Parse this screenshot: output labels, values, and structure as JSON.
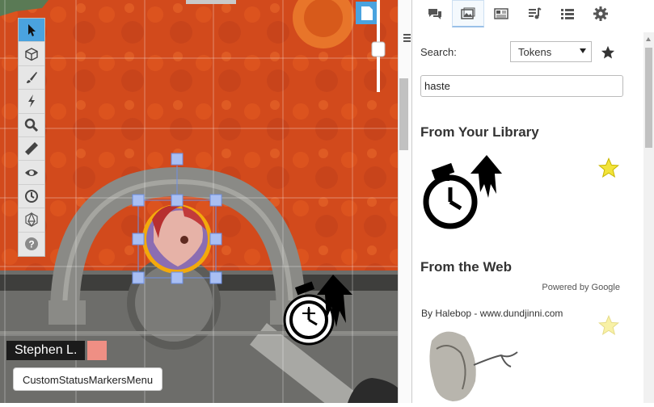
{
  "left_panel": {
    "player_name": "Stephen L.",
    "player_color": "#ef8f84",
    "status_markers_button": "CustomStatusMarkersMenu",
    "toolbar": [
      {
        "name": "select",
        "icon": "pointer-icon",
        "active": true
      },
      {
        "name": "token-layer",
        "icon": "cube-icon"
      },
      {
        "name": "draw",
        "icon": "brush-icon"
      },
      {
        "name": "fx",
        "icon": "lightning-icon"
      },
      {
        "name": "zoom",
        "icon": "magnifier-icon"
      },
      {
        "name": "measure",
        "icon": "ruler-icon"
      },
      {
        "name": "fog",
        "icon": "eye-icon"
      },
      {
        "name": "turn-tracker",
        "icon": "clock-icon"
      },
      {
        "name": "dice",
        "icon": "d20-icon"
      },
      {
        "name": "help",
        "icon": "help-icon"
      }
    ]
  },
  "sidebar": {
    "tabs": [
      {
        "name": "chat",
        "icon": "chat-bubbles-icon"
      },
      {
        "name": "art-library",
        "icon": "image-icon",
        "active": true
      },
      {
        "name": "journal",
        "icon": "newspaper-icon"
      },
      {
        "name": "jukebox",
        "icon": "music-list-icon"
      },
      {
        "name": "card-decks",
        "icon": "list-icon"
      },
      {
        "name": "settings",
        "icon": "gear-icon"
      }
    ],
    "search_label": "Search:",
    "search_type": "Tokens",
    "search_value": "haste",
    "library_title": "From Your Library",
    "web_title": "From the Web",
    "powered_by": "Powered by Google",
    "attribution": "By Halebop - www.dundjinni.com"
  },
  "colors": {
    "accent": "#4aa3df",
    "lava": "#d4481f",
    "selection": "#a9bff3",
    "star": "#f2e33a"
  }
}
